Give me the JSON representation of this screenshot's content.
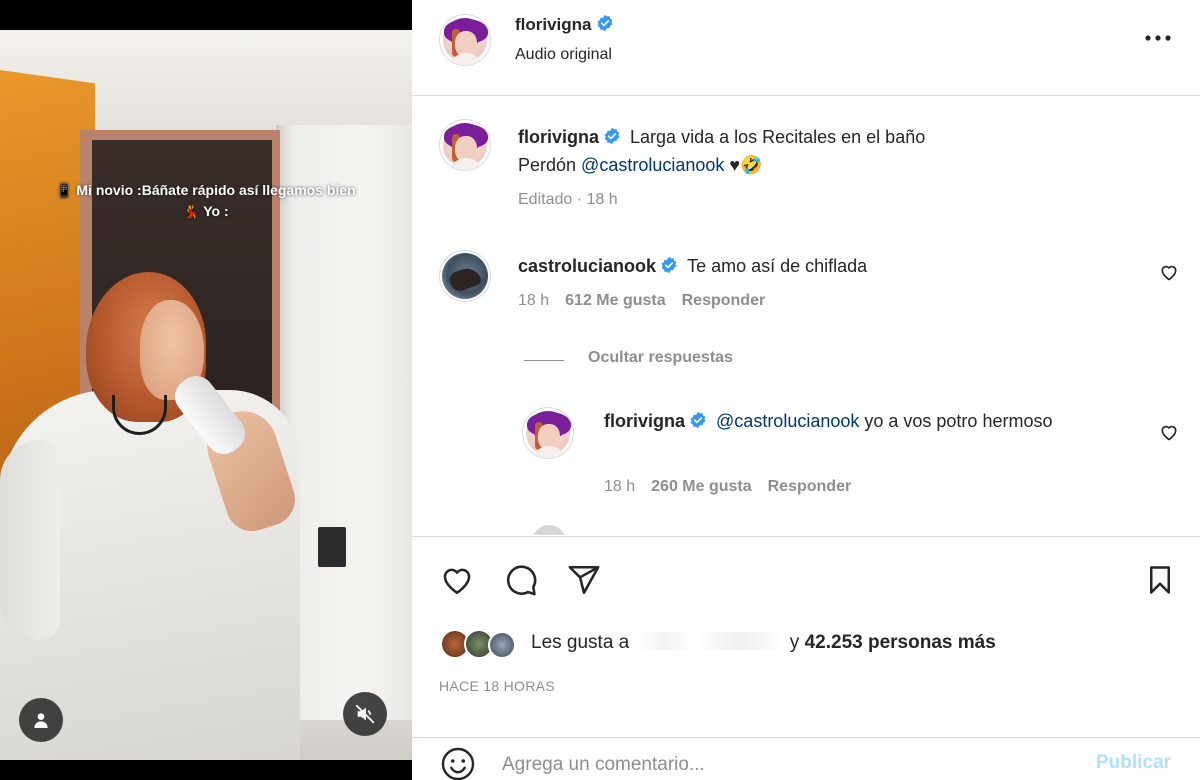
{
  "video": {
    "overlay_line1": "Mi novio :Báñate rápido así llegamos bien",
    "overlay_line2": "Yo :",
    "emoji1": "📱",
    "emoji2": "💃"
  },
  "header": {
    "username": "florivigna",
    "subtitle": "Audio original"
  },
  "caption": {
    "username": "florivigna",
    "text_line1": "Larga vida a los Recitales en el baño",
    "text_prefix": "Perdón ",
    "mention": "@castrolucianook",
    "text_suffix": " ♥🤣",
    "meta": "Editado · 18 h"
  },
  "comments": [
    {
      "username": "castrolucianook",
      "text": "Te amo así de chiflada",
      "time": "18 h",
      "likes": "612 Me gusta",
      "reply_label": "Responder"
    }
  ],
  "replies_toggle": "Ocultar respuestas",
  "replies": [
    {
      "username": "florivigna",
      "mention": "@castrolucianook",
      "text": " yo a vos potro hermoso",
      "time": "18 h",
      "likes": "260 Me gusta",
      "reply_label": "Responder"
    }
  ],
  "likes": {
    "prefix": "Les gusta a ",
    "suffix_before": " y ",
    "count": "42.253 personas más"
  },
  "time_ago": "HACE 18 HORAS",
  "composer": {
    "placeholder": "Agrega un comentario...",
    "publish": "Publicar"
  },
  "colors": {
    "verified": "#3897f0",
    "mention": "#00376b",
    "publish_disabled": "#b2dffc"
  }
}
